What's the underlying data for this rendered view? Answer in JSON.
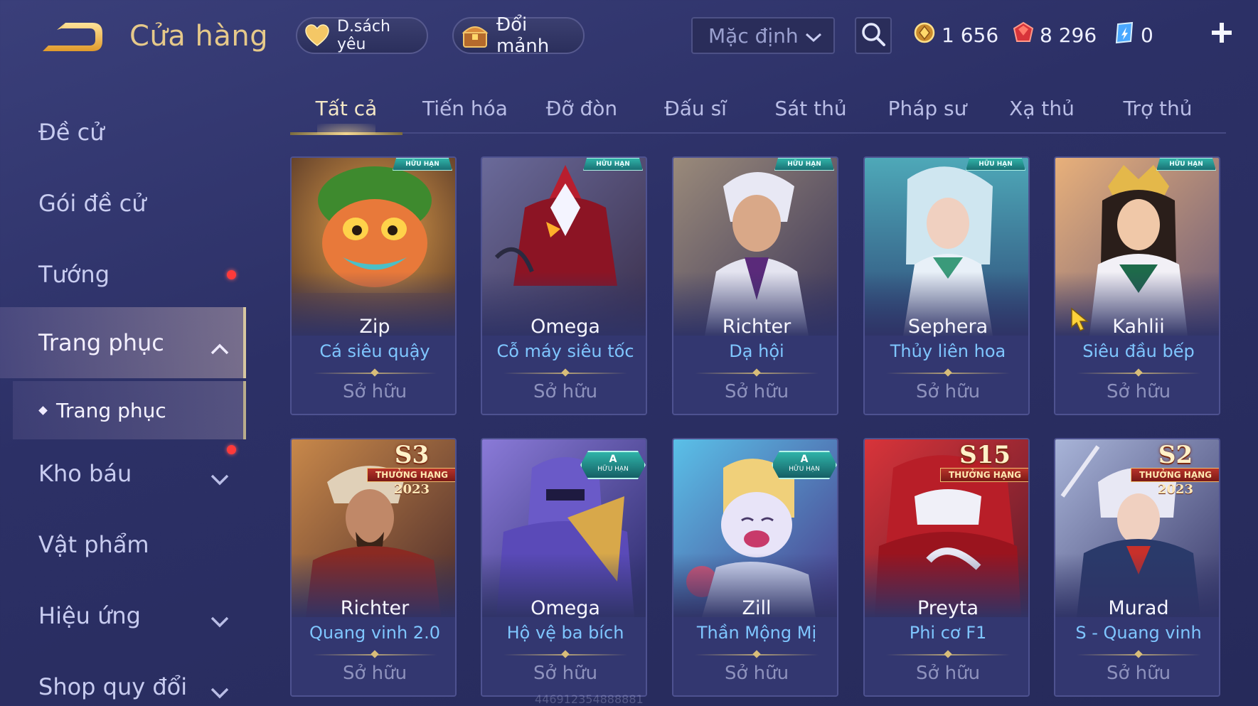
{
  "header": {
    "title": "Cửa hàng",
    "favorites_label": "D.sách yêu",
    "shard_label": "Đổi mảnh",
    "sort_value": "Mặc định"
  },
  "currency": {
    "gold": "1 656",
    "voucher": "8 296",
    "gem": "0"
  },
  "sidebar": {
    "items": [
      {
        "label": "Đề cử"
      },
      {
        "label": "Gói đề cử"
      },
      {
        "label": "Tướng"
      },
      {
        "label": "Trang phục"
      },
      {
        "label": "Kho báu"
      },
      {
        "label": "Vật phẩm"
      },
      {
        "label": "Hiệu ứng"
      },
      {
        "label": "Shop quy đổi"
      }
    ],
    "sub_item": "Trang phục"
  },
  "tabs": [
    "Tất cả",
    "Tiến hóa",
    "Đỡ đòn",
    "Đấu sĩ",
    "Sát thủ",
    "Pháp sư",
    "Xạ thủ",
    "Trợ thủ"
  ],
  "badges": {
    "limited": "HỮU HẠN",
    "a_letter": "A",
    "rank": "THƯỞNG HẠNG"
  },
  "owned_label": "Sở hữu",
  "cards": [
    {
      "hero": "Zip",
      "skin": "Cá siêu quậy",
      "owned": "Sở hữu",
      "badge": "HỮU HẠN"
    },
    {
      "hero": "Omega",
      "skin": "Cỗ máy siêu tốc",
      "owned": "Sở hữu",
      "badge": "HỮU HẠN"
    },
    {
      "hero": "Richter",
      "skin": "Dạ hội",
      "owned": "Sở hữu",
      "badge": "HỮU HẠN"
    },
    {
      "hero": "Sephera",
      "skin": "Thủy liên hoa",
      "owned": "Sở hữu",
      "badge": "HỮU HẠN"
    },
    {
      "hero": "Kahlii",
      "skin": "Siêu đầu bếp",
      "owned": "Sở hữu",
      "badge": "HỮU HẠN"
    },
    {
      "hero": "Richter",
      "skin": "Quang vinh 2.0",
      "owned": "Sở hữu",
      "season": "S3",
      "year": "2023"
    },
    {
      "hero": "Omega",
      "skin": "Hộ vệ ba bích",
      "owned": "Sở hữu",
      "badge": "A"
    },
    {
      "hero": "Zill",
      "skin": "Thần Mộng Mị",
      "owned": "Sở hữu",
      "badge": "A"
    },
    {
      "hero": "Preyta",
      "skin": "Phi cơ F1",
      "owned": "Sở hữu",
      "season": "S15"
    },
    {
      "hero": "Murad",
      "skin": "S - Quang vinh",
      "owned": "Sở hữu",
      "season": "S2",
      "year": "2023"
    }
  ],
  "watermark": "446912354888881",
  "colors": {
    "accent_gold": "#e6c98a",
    "skin_name_blue": "#7fc6ff",
    "notification_red": "#ff3a3a"
  }
}
